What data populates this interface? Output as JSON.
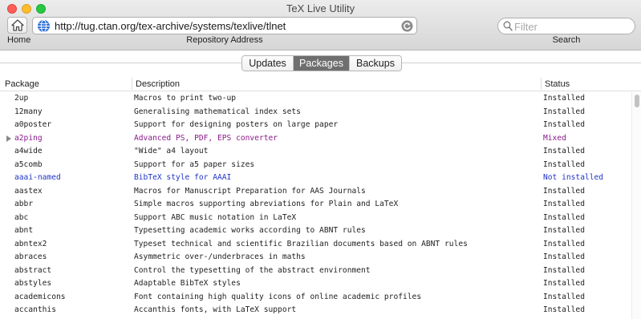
{
  "window": {
    "title": "TeX Live Utility"
  },
  "toolbar": {
    "home_label": "Home",
    "address_value": "http://tug.ctan.org/tex-archive/systems/texlive/tlnet",
    "address_label": "Repository Address",
    "search_placeholder": "Filter",
    "search_label": "Search"
  },
  "tabs": [
    {
      "label": "Updates"
    },
    {
      "label": "Packages",
      "selected": true
    },
    {
      "label": "Backups"
    }
  ],
  "table": {
    "columns": [
      "Package",
      "Description",
      "Status"
    ],
    "status_colors": {
      "Installed": "#222222",
      "Mixed": "#8b1a8b",
      "Not installed": "#2035c9"
    },
    "rows": [
      {
        "name": "2up",
        "description": "Macros to print two-up",
        "status": "Installed"
      },
      {
        "name": "12many",
        "description": "Generalising mathematical index sets",
        "status": "Installed"
      },
      {
        "name": "a0poster",
        "description": "Support for designing posters on large paper",
        "status": "Installed"
      },
      {
        "name": "a2ping",
        "description": "Advanced PS, PDF, EPS converter",
        "status": "Mixed",
        "expandable": true
      },
      {
        "name": "a4wide",
        "description": "\"Wide\" a4 layout",
        "status": "Installed"
      },
      {
        "name": "a5comb",
        "description": "Support for a5 paper sizes",
        "status": "Installed"
      },
      {
        "name": "aaai-named",
        "description": "BibTeX style for AAAI",
        "status": "Not installed"
      },
      {
        "name": "aastex",
        "description": "Macros for Manuscript Preparation for AAS Journals",
        "status": "Installed"
      },
      {
        "name": "abbr",
        "description": "Simple macros supporting abreviations for Plain and LaTeX",
        "status": "Installed"
      },
      {
        "name": "abc",
        "description": "Support ABC music notation in LaTeX",
        "status": "Installed"
      },
      {
        "name": "abnt",
        "description": "Typesetting academic works according to ABNT rules",
        "status": "Installed"
      },
      {
        "name": "abntex2",
        "description": "Typeset technical and scientific Brazilian documents based on ABNT rules",
        "status": "Installed"
      },
      {
        "name": "abraces",
        "description": "Asymmetric over-/underbraces in maths",
        "status": "Installed"
      },
      {
        "name": "abstract",
        "description": "Control the typesetting of the abstract environment",
        "status": "Installed"
      },
      {
        "name": "abstyles",
        "description": "Adaptable BibTeX styles",
        "status": "Installed"
      },
      {
        "name": "academicons",
        "description": "Font containing high quality icons of online academic profiles",
        "status": "Installed"
      },
      {
        "name": "accanthis",
        "description": "Accanthis fonts, with LaTeX support",
        "status": "Installed"
      }
    ]
  }
}
